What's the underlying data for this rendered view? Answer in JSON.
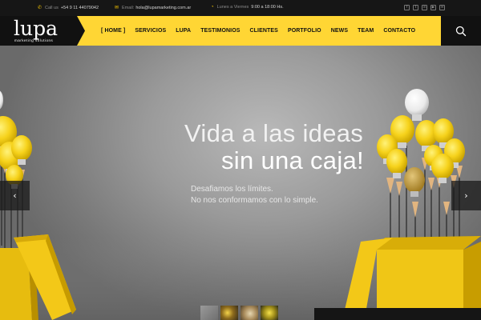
{
  "topbar": {
    "phone": "+54 9 11 44079042",
    "phone_prefix": "Call us",
    "email_prefix": "Email:",
    "email": "hola@lupamarketing.com.ar",
    "hours_prefix": "Lunes a Viernes",
    "hours": "9:00 a 18:00 Hs.",
    "icons": {
      "phone": "phone-icon",
      "email": "envelope-icon",
      "hours": "clock-icon"
    },
    "social": [
      {
        "name": "facebook-icon",
        "glyph": "f"
      },
      {
        "name": "twitter-icon",
        "glyph": "t"
      },
      {
        "name": "linkedin-icon",
        "glyph": "in"
      },
      {
        "name": "youtube-icon",
        "glyph": "▶"
      },
      {
        "name": "mail-icon",
        "glyph": "✉"
      }
    ]
  },
  "brand": {
    "logo_text": "lupa",
    "tagline": "marketing solutions"
  },
  "nav": {
    "items": [
      "[ HOME ]",
      "SERVICIOS",
      "LUPA",
      "TESTIMONIOS",
      "CLIENTES",
      "PORTFOLIO",
      "NEWS",
      "TEAM",
      "CONTACTO"
    ],
    "search_icon": "search-icon"
  },
  "hero": {
    "headline_1": "Vida a las ideas",
    "headline_2": "sin una caja!",
    "subline_1": "Desafiamos los límites.",
    "subline_2": "No nos conformamos con lo simple.",
    "prev_icon": "chevron-left-icon",
    "next_icon": "chevron-right-icon",
    "prev_glyph": "‹",
    "next_glyph": "›",
    "slide_count": 4
  },
  "colors": {
    "accent": "#ffd634",
    "topbar_bg": "#161616",
    "dark": "#111111",
    "bulb_yellow": "#f6d21b"
  }
}
